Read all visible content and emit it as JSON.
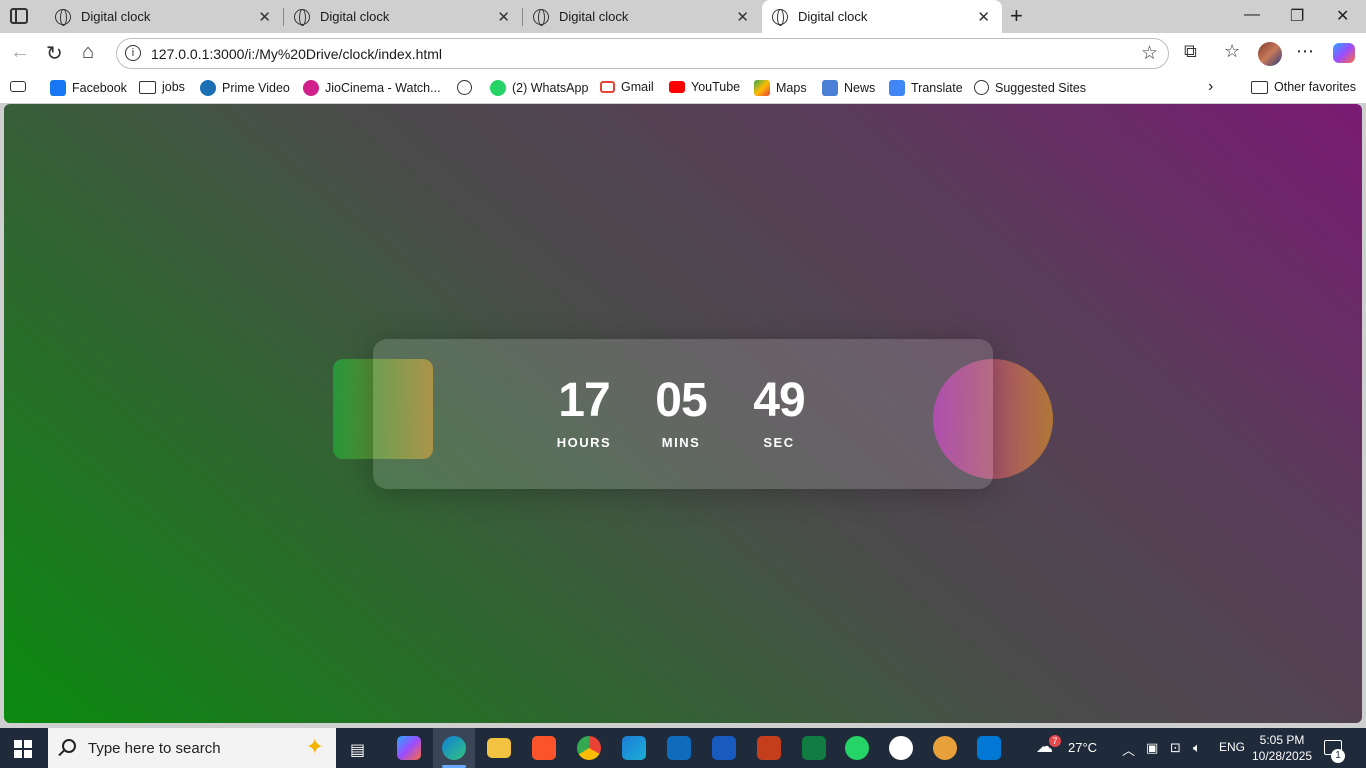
{
  "browser": {
    "tabs": [
      {
        "title": "Digital clock",
        "active": false
      },
      {
        "title": "Digital clock",
        "active": false
      },
      {
        "title": "Digital clock",
        "active": false
      },
      {
        "title": "Digital clock",
        "active": true
      }
    ],
    "close_glyph": "✕",
    "new_tab_glyph": "+",
    "url": "127.0.0.1:3000/i:/My%20Drive/clock/index.html",
    "bookmarks": [
      {
        "label": "Facebook",
        "icon": "facebook-icon",
        "color": "#1877f2"
      },
      {
        "label": "jobs",
        "icon": "folder-icon"
      },
      {
        "label": "Prime Video",
        "icon": "prime-video-icon",
        "color": "#1a6fb5"
      },
      {
        "label": "JioCinema - Watch...",
        "icon": "jiocinema-icon",
        "color": "#d0208a"
      },
      {
        "label": "",
        "icon": "globe-icon"
      },
      {
        "label": "(2) WhatsApp",
        "icon": "whatsapp-icon",
        "color": "#25d366"
      },
      {
        "label": "Gmail",
        "icon": "gmail-icon",
        "color": "#ea4335"
      },
      {
        "label": "YouTube",
        "icon": "youtube-icon",
        "color": "#ff0000"
      },
      {
        "label": "Maps",
        "icon": "maps-icon",
        "color": "#34a853"
      },
      {
        "label": "News",
        "icon": "news-icon",
        "color": "#4a7fd6"
      },
      {
        "label": "Translate",
        "icon": "translate-icon",
        "color": "#4285f4"
      },
      {
        "label": "Suggested Sites",
        "icon": "globe-icon"
      }
    ],
    "other_favorites": "Other favorites"
  },
  "clock": {
    "hours": "17",
    "mins": "05",
    "sec": "49",
    "hours_label": "HOURS",
    "mins_label": "MINS",
    "sec_label": "SEC"
  },
  "taskbar": {
    "search_placeholder": "Type here to search",
    "temperature": "27°C",
    "language": "ENG",
    "time": "5:05 PM",
    "date": "10/28/2025",
    "notification_count": "1",
    "weather_badge": "7"
  }
}
